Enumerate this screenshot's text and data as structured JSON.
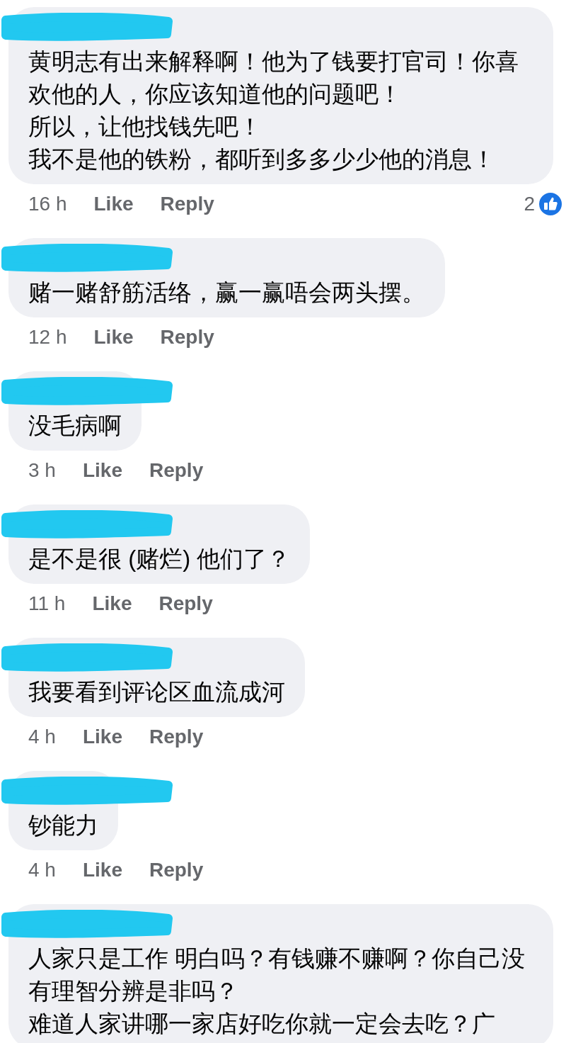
{
  "comments": [
    {
      "lines": [
        "黄明志有出来解释啊！他为了钱要打官司！你喜欢他的人，你应该知道他的问题吧！",
        "所以，让他找钱先吧！",
        "我不是他的铁粉，都听到多多少少他的消息！"
      ],
      "time": "16 h",
      "like": "Like",
      "reply": "Reply",
      "reactions": {
        "count": "2"
      }
    },
    {
      "lines": [
        "赌一赌舒筋活络，赢一赢唔会两头摆。"
      ],
      "time": "12 h",
      "like": "Like",
      "reply": "Reply"
    },
    {
      "lines": [
        "没毛病啊"
      ],
      "time": "3 h",
      "like": "Like",
      "reply": "Reply"
    },
    {
      "lines": [
        "是不是很 (赌烂) 他们了？"
      ],
      "time": "11 h",
      "like": "Like",
      "reply": "Reply"
    },
    {
      "lines": [
        "我要看到评论区血流成河"
      ],
      "time": "4 h",
      "like": "Like",
      "reply": "Reply"
    },
    {
      "lines": [
        "钞能力"
      ],
      "time": "4 h",
      "like": "Like",
      "reply": "Reply"
    },
    {
      "lines": [
        "人家只是工作 明白吗？有钱赚不赚啊？你自己没有理智分辨是非吗？",
        "难道人家讲哪一家店好吃你就一定会去吃？广"
      ]
    }
  ]
}
